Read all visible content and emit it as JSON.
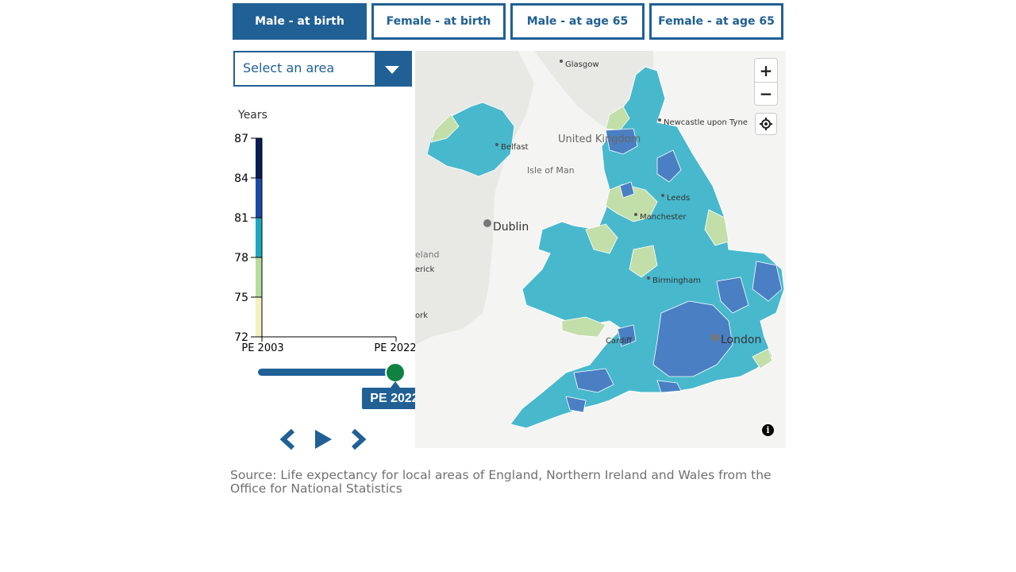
{
  "tabs": [
    {
      "label": "Male - at birth",
      "active": true
    },
    {
      "label": "Female - at birth",
      "active": false
    },
    {
      "label": "Male - at age 65",
      "active": false
    },
    {
      "label": "Female - at age 65",
      "active": false
    }
  ],
  "area_select": {
    "placeholder": "Select an area"
  },
  "legend": {
    "title": "Years",
    "ticks": [
      "87",
      "84",
      "81",
      "78",
      "75",
      "72"
    ],
    "colors": [
      "#081d58",
      "#1b49a6",
      "#1fa7c0",
      "#b6dc9e",
      "#f5f0c0"
    ],
    "x_start": "PE 2003",
    "x_end": "PE 2022"
  },
  "slider": {
    "value_label": "PE 2022",
    "position_fraction": 1.0
  },
  "map": {
    "place_labels": {
      "glasgow": "Glasgow",
      "belfast": "Belfast",
      "united_kingdom": "United Kingdom",
      "isle_of_man": "Isle of Man",
      "newcastle": "Newcastle upon Tyne",
      "leeds": "Leeds",
      "manchester": "Manchester",
      "dublin": "Dublin",
      "ireland_partial": "eland",
      "limerick_partial": "erick",
      "cork_partial": "ork",
      "birmingham": "Birmingham",
      "cardiff": "Cardiff",
      "london": "London"
    },
    "region_colors": {
      "very_high": "#4a7fc3",
      "high": "#48b8cd",
      "mid": "#c2dfa9",
      "land": "#e8e8e4",
      "sea": "#f4f4f2"
    }
  },
  "source_text": "Source: Life expectancy for local areas of England, Northern Ireland and Wales from the Office for National Statistics",
  "icons": {
    "zoom_in": "plus-icon",
    "zoom_out": "minus-icon",
    "locate": "locate-icon",
    "info": "info-icon",
    "prev": "chevron-left-icon",
    "play": "play-icon",
    "next": "chevron-right-icon"
  }
}
